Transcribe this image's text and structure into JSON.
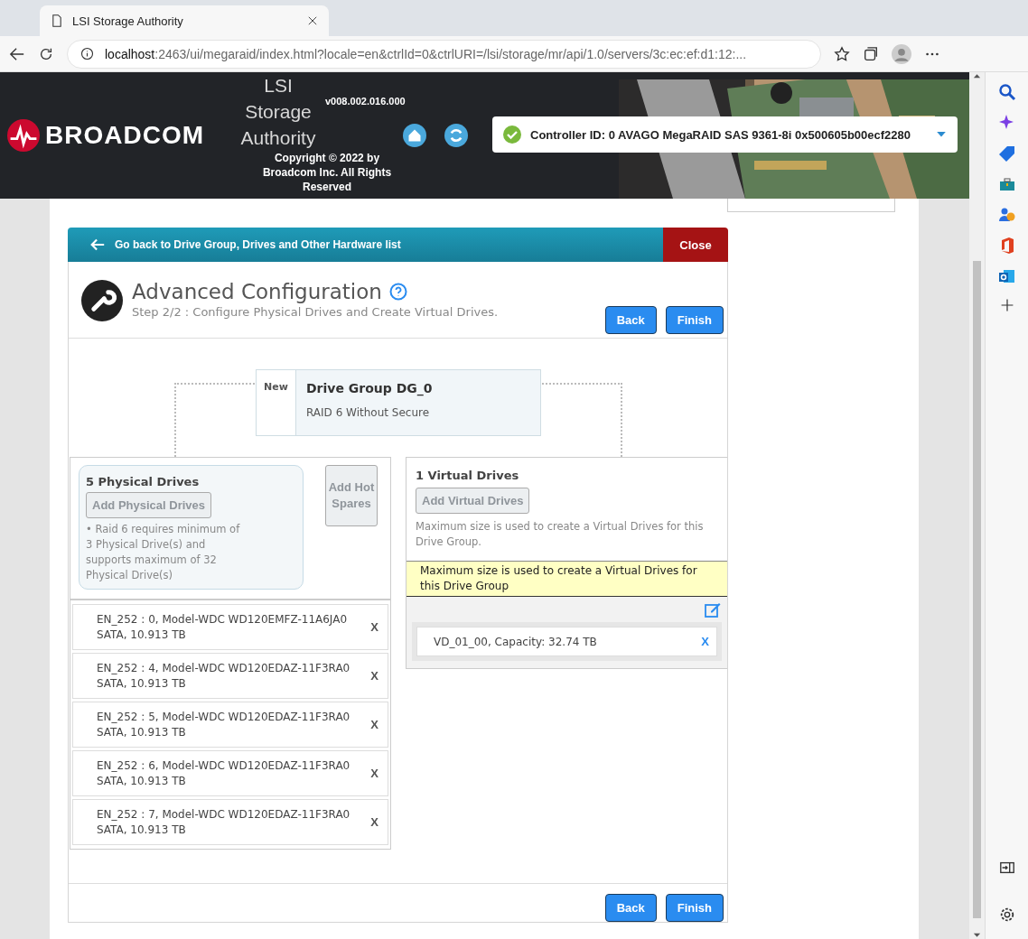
{
  "browser": {
    "tab_title": "LSI Storage Authority",
    "url_host": "localhost",
    "url_rest": ":2463/ui/megaraid/index.html?locale=en&ctrlId=0&ctrlURI=/lsi/storage/mr/api/1.0/servers/3c:ec:ef:d1:12:..."
  },
  "header": {
    "logo": "BROADCOM",
    "app_name": "LSI Storage Authority",
    "version": "v008.002.016.000",
    "copyright": "Copyright © 2022 by Broadcom Inc. All Rights Reserved",
    "controller": "Controller ID: 0 AVAGO MegaRAID SAS 9361-8i 0x500605b00ecf2280"
  },
  "panel": {
    "back_link": "Go back to Drive Group, Drives and Other Hardware list",
    "close": "Close",
    "title": "Advanced Configuration",
    "subtitle": "Step 2/2 : Configure Physical Drives and Create Virtual Drives.",
    "buttons": [
      "Back",
      "Finish"
    ],
    "drive_group": {
      "badge": "New",
      "name": "Drive Group DG_0",
      "raid": "RAID 6 Without Secure"
    },
    "physical": {
      "title": "5 Physical Drives",
      "add_button": {
        "label": "Add Physical Drives",
        "disabled": true
      },
      "hot_spares_button": {
        "label": "Add Hot Spares",
        "disabled": true
      },
      "note": "• Raid 6 requires minimum of 3 Physical Drive(s) and supports maximum of 32 Physical Drive(s)",
      "drives": [
        {
          "line1": "EN_252 : 0, Model-WDC WD120EMFZ-11A6JA0",
          "line2": "SATA, 10.913 TB",
          "remove": "X"
        },
        {
          "line1": "EN_252 : 4, Model-WDC WD120EDAZ-11F3RA0",
          "line2": "SATA, 10.913 TB",
          "remove": "X"
        },
        {
          "line1": "EN_252 : 5, Model-WDC WD120EDAZ-11F3RA0",
          "line2": "SATA, 10.913 TB",
          "remove": "X"
        },
        {
          "line1": "EN_252 : 6, Model-WDC WD120EDAZ-11F3RA0",
          "line2": "SATA, 10.913 TB",
          "remove": "X"
        },
        {
          "line1": "EN_252 : 7, Model-WDC WD120EDAZ-11F3RA0",
          "line2": "SATA, 10.913 TB",
          "remove": "X"
        }
      ]
    },
    "virtual": {
      "title": "1 Virtual Drives",
      "add_button": {
        "label": "Add Virtual Drives",
        "disabled": true
      },
      "note": "Maximum size is used to create a Virtual Drives for this Drive Group.",
      "warning": "Maximum size is used to create a Virtual Drives for this Drive Group",
      "drives": [
        {
          "label": "VD_01_00, Capacity: 32.74 TB",
          "remove": "X"
        }
      ]
    },
    "bottom_buttons": [
      "Back",
      "Finish"
    ]
  }
}
